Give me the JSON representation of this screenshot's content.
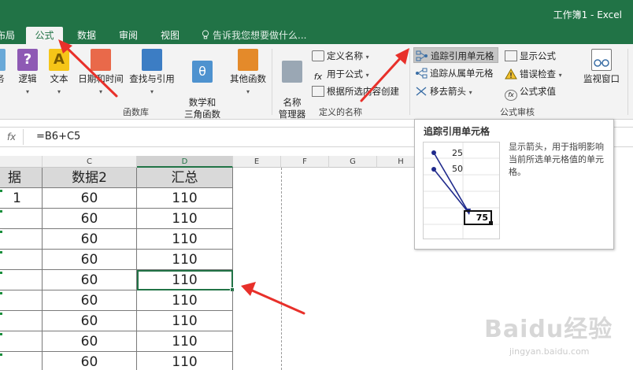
{
  "app": {
    "title": "工作簿1 - Excel"
  },
  "tabs": [
    {
      "label": "布局",
      "active": false
    },
    {
      "label": "公式",
      "active": true
    },
    {
      "label": "数据",
      "active": false
    },
    {
      "label": "审阅",
      "active": false
    },
    {
      "label": "视图",
      "active": false
    }
  ],
  "tell_me": "告诉我您想要做什么...",
  "ribbon": {
    "function_library": {
      "label": "函数库",
      "buttons": [
        "逻辑",
        "文本",
        "日期和时间",
        "查找与引用",
        "数学和\n三角函数",
        "其他函数"
      ],
      "partial_button": "务"
    },
    "defined_names": {
      "label": "定义的名称",
      "name_manager": "名称\n管理器",
      "define_name": "定义名称",
      "use_in_formula": "用于公式",
      "create_from_selection": "根据所选内容创建"
    },
    "formula_auditing": {
      "label": "公式审核",
      "trace_precedents": "追踪引用单元格",
      "trace_dependents": "追踪从属单元格",
      "remove_arrows": "移去箭头",
      "show_formulas": "显示公式",
      "error_checking": "错误检查",
      "evaluate_formula": "公式求值",
      "watch_window": "监视窗口"
    }
  },
  "formula_bar": {
    "fx": "fx",
    "formula": "=B6+C5"
  },
  "columns": [
    "C",
    "D",
    "E",
    "F",
    "G",
    "H"
  ],
  "grid": {
    "header_row": {
      "b_partial": "据1",
      "c": "数据2",
      "d": "汇总"
    },
    "rows": [
      {
        "c": "60",
        "d": "110"
      },
      {
        "c": "60",
        "d": "110"
      },
      {
        "c": "60",
        "d": "110"
      },
      {
        "c": "60",
        "d": "110"
      },
      {
        "c": "60",
        "d": "110"
      },
      {
        "c": "60",
        "d": "110"
      },
      {
        "c": "60",
        "d": "110"
      },
      {
        "c": "60",
        "d": "110"
      },
      {
        "c": "60",
        "d": "110"
      }
    ]
  },
  "tooltip": {
    "title": "追踪引用单元格",
    "description": "显示箭头，用于指明影响当前所选单元格值的单元格。",
    "example_values": [
      "25",
      "50",
      "75"
    ]
  },
  "watermark": {
    "text": "Baidu经验",
    "url_text": "jingyan.baidu.com"
  },
  "colors": {
    "excel_green": "#217346",
    "annotation_red": "#e8302a"
  }
}
